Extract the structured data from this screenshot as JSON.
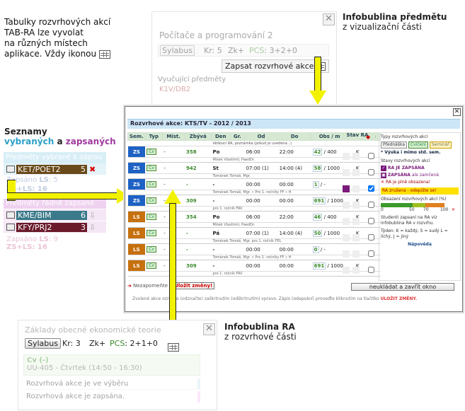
{
  "left_note": {
    "lines": [
      "Tabulky rozvrhových akcí",
      "TAB-RA lze vyvolat",
      "na různých místech",
      "aplikace. Vždy ikonou"
    ]
  },
  "top_bubble": {
    "heading": "Infobublina předmětu",
    "sub": "z vizualizační části",
    "course_title": "Počítače a programování 2",
    "syllabus_label": "Sylabus",
    "kr": "Kr: 5",
    "zk": "Zk+",
    "pcs_label": "PCS",
    "pcs_value": ": 3+2+0",
    "zapsat_label": "Zapsat rozvrhové akce",
    "teachers_label": "Vyučující předměty",
    "teacher_code": "K1V/DB2"
  },
  "lists": {
    "heading_line1": "Seznamy",
    "heading_vybrane": "vybraných",
    "heading_a": " a ",
    "heading_zapsane": "zapsaných",
    "selected_header": "Předměty vybrané k zápisu",
    "selected_items": [
      {
        "code": "KET/POET2",
        "credits": "5"
      }
    ],
    "selected_sum_prefix": "Zapsáno",
    "selected_sum_ls": "LS",
    "selected_sum_value": ": 5",
    "selected_zs": "ZS+LS: 16",
    "enrolled_header": "Předměty řádně zapsané",
    "enrolled_items": [
      {
        "code": "KME/BIM",
        "credits": "6"
      },
      {
        "code": "KFY/PRJ2",
        "credits": "3"
      }
    ],
    "enrolled_sum_prefix": "Zapsáno",
    "enrolled_sum_ls": "LS",
    "enrolled_sum_value": ": 9",
    "enrolled_zs": "ZS+LS: 16"
  },
  "dialog": {
    "title": "Rozvrhové akce: KTS/TV - 2012 / 2013",
    "headers": [
      "Sem.",
      "Typ",
      "Míst.",
      "Zbývá",
      "Den",
      "Gr.",
      "Od",
      "Do",
      "Obs / max",
      "Týden",
      "Stav RA"
    ],
    "subheader": "Vedoucí RA, poznámka (pokud je uvedena...)",
    "rows": [
      {
        "sem": "ZS",
        "typ": "Cv",
        "mist": "-",
        "zbyva": "358",
        "den": "Po",
        "od": "06:00",
        "do": "22:00",
        "obs": "42",
        "max": "/ 400",
        "tyden": "K",
        "note": "Mišek Vlastimil, PaedDr."
      },
      {
        "sem": "ZS",
        "typ": "Cv",
        "mist": "-",
        "zbyva": "942",
        "den": "St",
        "od": "07:00 (1)",
        "do": "14:00 (4)",
        "obs": "58",
        "max": "/ 1000",
        "tyden": "K",
        "note": "Tománek Tomáš, Mgr."
      },
      {
        "sem": "ZS",
        "typ": "Cv",
        "mist": "-",
        "zbyva": "-",
        "den": "-",
        "od": "00:00",
        "do": "00:00",
        "obs": "1",
        "max": "/ -",
        "tyden": "",
        "note": "Tománek Tomáš, Mgr. « Pro 1. ročníky FF » H"
      },
      {
        "sem": "ZS",
        "typ": "Cv",
        "mist": "-",
        "zbyva": "309",
        "den": "-",
        "od": "00:00",
        "do": "00:00",
        "obs": "691",
        "max": "/ 1000",
        "tyden": "K",
        "note": "pro 1. ročník FAV"
      },
      {
        "sem": "LS",
        "typ": "Cv",
        "mist": "-",
        "zbyva": "354",
        "den": "Po",
        "od": "06:00",
        "do": "22:00",
        "obs": "46",
        "max": "/ 400",
        "tyden": "K",
        "note": "Mišek Vlastimil, PaedDr."
      },
      {
        "sem": "LS",
        "typ": "Cv",
        "mist": "-",
        "zbyva": "-",
        "den": "Pá",
        "od": "07:00 (1)",
        "do": "14:00 (4)",
        "obs": "50",
        "max": "/ 1000",
        "tyden": "K",
        "note": "Tománek Tomáš, Mgr. pro 1. ročník FEL"
      },
      {
        "sem": "LS",
        "typ": "Cv",
        "mist": "-",
        "zbyva": "-",
        "den": "-",
        "od": "00:00",
        "do": "00:00",
        "obs": "0",
        "max": "/ -",
        "tyden": "",
        "note": "Tománek Tomáš, Mgr. « Pro 1. ročníky FF » H"
      },
      {
        "sem": "LS",
        "typ": "Cv",
        "mist": "-",
        "zbyva": "309",
        "den": "-",
        "od": "00:00",
        "do": "00:00",
        "obs": "691",
        "max": "/ 1000",
        "tyden": "K",
        "note": "pro 1. ročník FAV"
      }
    ],
    "legend": {
      "types_title": "Typy rozvrhových akcí",
      "type_predn": "Přednáška",
      "type_cv": "Cvičení",
      "type_sem": "Seminář",
      "vyuka_note": "* Výuka i mimo std. sem.",
      "states_title": "Stavy rozvrhových akcí",
      "ra_zapsana": "RA JE ZAPSÁNA",
      "ra_zapsana_note": "",
      "zapsana": "ZAPSÁNA",
      "zapsana_note": "ale zamčená",
      "ra_plne": "RA je plně obsazena!",
      "ra_zrusena": "RA zrušena - odepište se!",
      "obsazeni_title": "Obsazení rozvrhových akcí (%)",
      "scale_0": "0",
      "scale_50": "50",
      "scale_70": "70",
      "scale_100": "100",
      "studenti_note": "Studenti zapsaní na RA viz infobublina RA v rozvrhu.",
      "tyden_note": "Týden: K = každý, S = sudý L = lichý, J = jiný",
      "napoveda": "Nápověda"
    },
    "nezapomente": "Nezapomeňte",
    "ulozit": "Uložit změny!",
    "neukladat": "neukládat a zavřít okno",
    "footer": "Zvolené akce označte (odznačte) zaškrtnutím (odškrtnutím) vpravo. Zápis (odepsání) proveďte kliknutím na tlačítko",
    "footer_red": "ULOŽIT ZMĚNY."
  },
  "bottom_bubble": {
    "heading": "Infobublina RA",
    "sub": "z rozvrhové části",
    "course_title": "Základy obecné ekonomické teorie",
    "syllabus_label": "Sylabus",
    "kr": "Kr: 3",
    "zk": "Zk+",
    "pcs_label": "PCS",
    "pcs_value": ": 2+1+0",
    "cv_label": "Cv (-)",
    "cv_room": "UU-405 - Čtvrtek (14:50 - 16:30)",
    "row1": "Rozvrhová akce je ve výběru",
    "row2": "Rozvrhová akce je zapsána."
  },
  "colors": {
    "zs": "#1d62c4",
    "ls": "#c6700e",
    "arrow": "#f2f200",
    "vybrane": "#2aa0c8",
    "zapsane": "#a03aa0"
  }
}
